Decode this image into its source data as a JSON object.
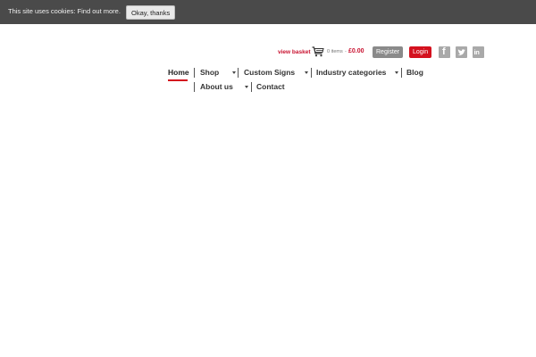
{
  "cookie_bar": {
    "message": "This site uses cookies:",
    "link": "Find out more.",
    "accept_label": "Okay, thanks",
    "background": "#4a4a4a"
  },
  "utility_bar": {
    "view_basket_label": "view basket",
    "basket_items": "0 items",
    "basket_separator": "-",
    "basket_total": "£0.00",
    "register_label": "Register",
    "login_label": "Login",
    "social_icons": [
      "facebook-icon",
      "twitter-icon",
      "linkedin-icon"
    ],
    "accent_color": "#d4111e"
  },
  "nav": {
    "items": [
      {
        "label": "Home",
        "active": true,
        "has_dropdown": false
      },
      {
        "label": "Shop",
        "active": false,
        "has_dropdown": true
      },
      {
        "label": "Custom Signs",
        "active": false,
        "has_dropdown": true
      },
      {
        "label": "Industry categories",
        "active": false,
        "has_dropdown": true
      },
      {
        "label": "Blog",
        "active": false,
        "has_dropdown": false
      },
      {
        "label": "About us",
        "active": false,
        "has_dropdown": true
      },
      {
        "label": "Contact",
        "active": false,
        "has_dropdown": false
      }
    ]
  }
}
